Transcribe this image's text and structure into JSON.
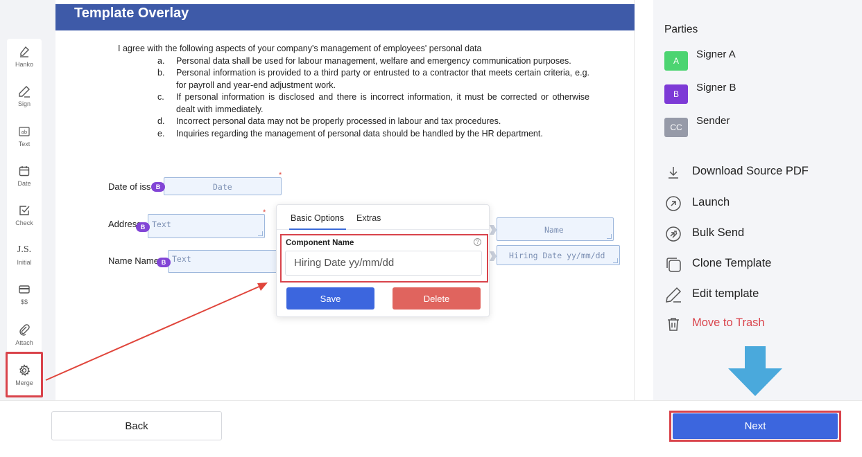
{
  "toolbar": {
    "items": [
      {
        "label": "Hanko",
        "icon": "hanko-icon"
      },
      {
        "label": "Sign",
        "icon": "pen-icon"
      },
      {
        "label": "Text",
        "icon": "text-box-icon"
      },
      {
        "label": "Date",
        "icon": "calendar-icon"
      },
      {
        "label": "Check",
        "icon": "checkbox-icon"
      },
      {
        "label": "Initial",
        "icon": "initial-icon",
        "glyph": "J.S."
      },
      {
        "label": "$$",
        "icon": "card-icon"
      },
      {
        "label": "Attach",
        "icon": "paperclip-icon"
      },
      {
        "label": "Merge",
        "icon": "gear-icon"
      }
    ]
  },
  "document": {
    "title": "Template Overlay",
    "intro": "I agree with the following aspects of your company's management of employees' personal data",
    "list": [
      {
        "marker": "a.",
        "text": "Personal data shall be used for labour management, welfare and emergency communication purposes."
      },
      {
        "marker": "b.",
        "text": "Personal information is provided to a third party or entrusted to a contractor that meets certain criteria, e.g. for payroll and year-end adjustment work."
      },
      {
        "marker": "c.",
        "text": "If personal information is disclosed and there is incorrect information, it must be corrected or otherwise dealt with immediately."
      },
      {
        "marker": "d.",
        "text": "Incorrect personal data may not be properly processed in labour and tax procedures."
      },
      {
        "marker": "e.",
        "text": "Inquiries regarding the management of personal data should be handled by the HR department."
      }
    ],
    "labels": {
      "date_of_issue": "Date of iss",
      "address": "Address",
      "name": "Name Name"
    },
    "fields": {
      "date": "Date",
      "address_text": "Text",
      "name_text": "Text",
      "name_right": "Name",
      "hiring_date": "Hiring Date yy/mm/dd"
    },
    "badge": "B"
  },
  "popup": {
    "tabs": [
      "Basic Options",
      "Extras"
    ],
    "component_label": "Component Name",
    "help": "?",
    "component_value": "Hiring Date yy/mm/dd",
    "save": "Save",
    "delete": "Delete"
  },
  "sidebar": {
    "parties_title": "Parties",
    "parties": [
      {
        "badge": "A",
        "name": "Signer A",
        "color": "#4cd471"
      },
      {
        "badge": "B",
        "name": "Signer B",
        "color": "#7d3ad6"
      },
      {
        "badge": "CC",
        "name": "Sender",
        "color": "#969aa8"
      }
    ],
    "actions": [
      {
        "label": "Download Source PDF",
        "icon": "download-icon"
      },
      {
        "label": "Launch",
        "icon": "launch-icon"
      },
      {
        "label": "Bulk Send",
        "icon": "bulk-send-icon"
      },
      {
        "label": "Clone Template",
        "icon": "clone-icon"
      },
      {
        "label": "Edit template",
        "icon": "edit-icon"
      },
      {
        "label": "Move to Trash",
        "icon": "trash-icon",
        "danger": true
      }
    ]
  },
  "footer": {
    "back": "Back",
    "next": "Next"
  },
  "colors": {
    "header": "#3e5aa8",
    "primary": "#3c66de",
    "danger": "#d9434b",
    "badge_purple": "#8245d6",
    "arrow_blue": "#4aa9dc"
  }
}
